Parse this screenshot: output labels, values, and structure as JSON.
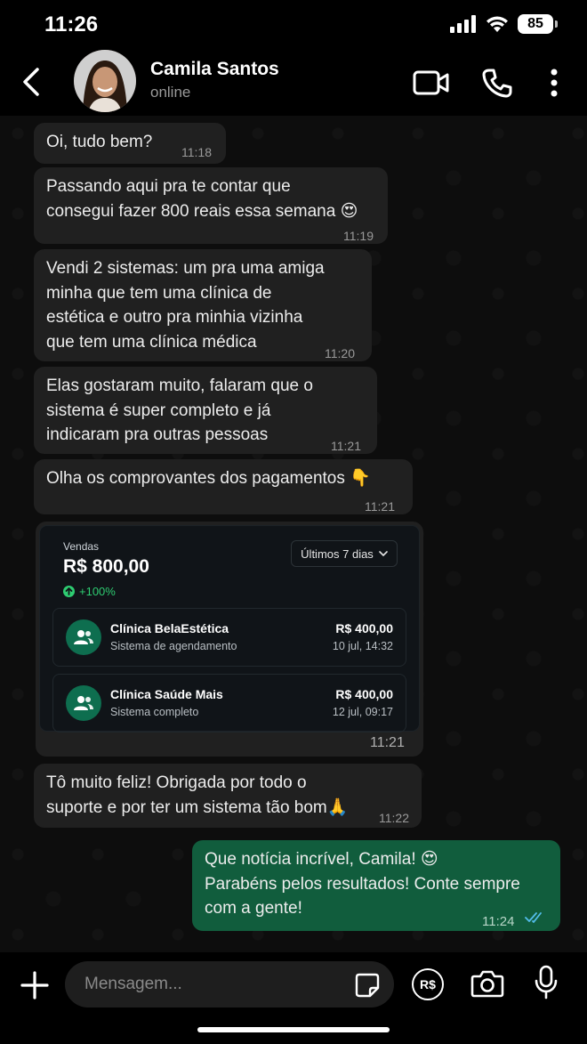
{
  "status_bar": {
    "time": "11:26",
    "battery": "85"
  },
  "contact": {
    "name": "Camila Santos",
    "status": "online"
  },
  "messages": [
    {
      "text": "Oi, tudo bem?",
      "time": "11:18"
    },
    {
      "line1": "Passando aqui pra te contar que",
      "line2": "consegui fazer 800 reais essa semana 😍",
      "time": "11:19"
    },
    {
      "line1": "Vendi 2 sistemas: um pra uma amiga",
      "line2": "minha que tem uma clínica de",
      "line3": "estética e outro pra minhia vizinha",
      "line4": "que tem uma clínica médica",
      "time": "11:20"
    },
    {
      "line1": "Elas gostaram muito, falaram que o",
      "line2": "sistema é super completo e já",
      "line3": "indicaram pra outras pessoas",
      "time": "11:21"
    },
    {
      "text": "Olha os comprovantes dos pagamentos 👇",
      "time": "11:21"
    },
    {
      "line1": "Tô muito feliz! Obrigada por todo o",
      "line2": "suporte e por ter um sistema tão bom🙏",
      "time": "11:22"
    },
    {
      "line1": "Que notícia incrível, Camila! 😍",
      "line2": "Parabéns pelos resultados! Conte sempre",
      "line3": "com a gente!",
      "time": "11:24"
    }
  ],
  "sales_card": {
    "label": "Vendas",
    "total": "R$ 800,00",
    "growth": "+100%",
    "period": "Últimos 7 dias",
    "time": "11:21",
    "sales": [
      {
        "name": "Clínica BelaEstética",
        "description": "Sistema de agendamento",
        "value": "R$ 400,00",
        "date": "10 jul, 14:32"
      },
      {
        "name": "Clínica Saúde Mais",
        "description": "Sistema completo",
        "value": "R$ 400,00",
        "date": "12 jul, 09:17"
      }
    ]
  },
  "composer": {
    "placeholder": "Mensagem...",
    "pay_label": "R$"
  },
  "colors": {
    "outgoing": "#115d3d",
    "incoming": "#202020",
    "read_ticks": "#53bdeb",
    "growth": "#2ecc71"
  }
}
